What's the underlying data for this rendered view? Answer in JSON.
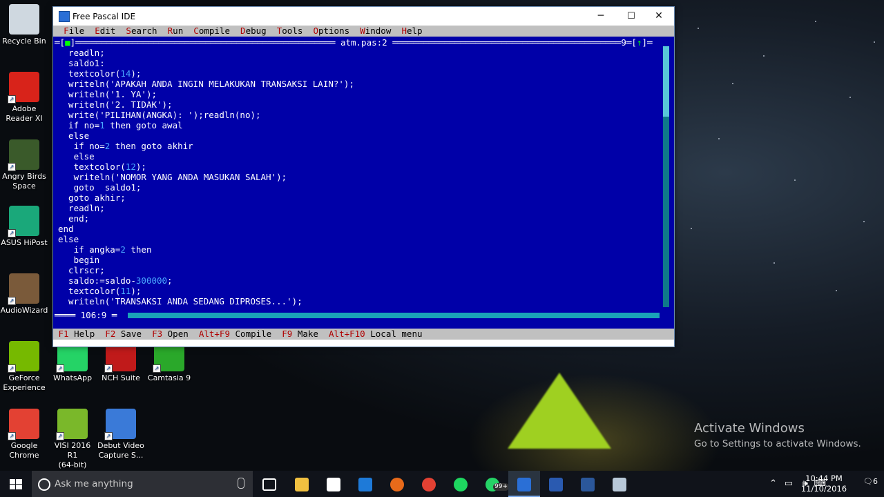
{
  "desktop": {
    "icons": [
      {
        "label": "Recycle Bin",
        "icon": "recycle-bin-icon",
        "color": "#cfd8e0"
      },
      {
        "label": "Adobe\nReader XI",
        "icon": "adobe-reader-icon",
        "color": "#d8231a"
      },
      {
        "label": "Angry Birds\nSpace",
        "icon": "angry-birds-icon",
        "color": "#3a5a2a"
      },
      {
        "label": "ASUS HiPost",
        "icon": "asus-hipost-icon",
        "color": "#1aa87a"
      },
      {
        "label": "AudioWizard",
        "icon": "audiowizard-icon",
        "color": "#7a5a3a"
      },
      {
        "label": "GeForce\nExperience",
        "icon": "geforce-icon",
        "color": "#76b900"
      },
      {
        "label": "WhatsApp",
        "icon": "whatsapp-icon",
        "color": "#25d366"
      },
      {
        "label": "NCH Suite",
        "icon": "nch-suite-icon",
        "color": "#c01a1a"
      },
      {
        "label": "Camtasia 9",
        "icon": "camtasia-icon",
        "color": "#2aa82a"
      },
      {
        "label": "Google\nChrome",
        "icon": "chrome-icon",
        "color": "#e34133"
      },
      {
        "label": "VISI 2016 R1\n(64-bit)",
        "icon": "visi-icon",
        "color": "#7ab82a"
      },
      {
        "label": "Debut Video\nCapture S...",
        "icon": "debut-icon",
        "color": "#3a7ad8"
      }
    ],
    "activate_title": "Activate Windows",
    "activate_sub": "Go to Settings to activate Windows."
  },
  "window": {
    "title": "Free Pascal IDE",
    "minimize": "─",
    "maximize": "☐",
    "close": "✕"
  },
  "menu": [
    {
      "hot": "F",
      "rest": "ile"
    },
    {
      "hot": "E",
      "rest": "dit"
    },
    {
      "hot": "S",
      "rest": "earch"
    },
    {
      "hot": "R",
      "rest": "un"
    },
    {
      "hot": "C",
      "rest": "ompile"
    },
    {
      "hot": "D",
      "rest": "ebug"
    },
    {
      "hot": "T",
      "rest": "ools"
    },
    {
      "hot": "O",
      "rest": "ptions"
    },
    {
      "hot": "W",
      "rest": "indow"
    },
    {
      "hot": "H",
      "rest": "elp"
    }
  ],
  "editor": {
    "close_box": "[■]",
    "filename": "atm.pas:2",
    "window_number": "9",
    "zoom_box": "[↑]",
    "cursor_pos": "106:9",
    "code_lines": [
      [
        {
          "t": "  readln;"
        }
      ],
      [
        {
          "t": "  saldo1:"
        }
      ],
      [
        {
          "t": "  textcolor("
        },
        {
          "t": "14",
          "c": "num"
        },
        {
          "t": ");"
        }
      ],
      [
        {
          "t": "  writeln("
        },
        {
          "t": "'APAKAH ANDA INGIN MELAKUKAN TRANSAKSI LAIN?'",
          "c": "str"
        },
        {
          "t": ");"
        }
      ],
      [
        {
          "t": "  writeln("
        },
        {
          "t": "'1. YA'",
          "c": "str"
        },
        {
          "t": ");"
        }
      ],
      [
        {
          "t": "  writeln("
        },
        {
          "t": "'2. TIDAK'",
          "c": "str"
        },
        {
          "t": ");"
        }
      ],
      [
        {
          "t": "  write("
        },
        {
          "t": "'PILIHAN(ANGKA): '",
          "c": "str"
        },
        {
          "t": ");readln(no);"
        }
      ],
      [
        {
          "t": "  if no="
        },
        {
          "t": "1",
          "c": "num"
        },
        {
          "t": " then goto awal"
        }
      ],
      [
        {
          "t": "  else"
        }
      ],
      [
        {
          "t": "   if no="
        },
        {
          "t": "2",
          "c": "num"
        },
        {
          "t": " then goto akhir"
        }
      ],
      [
        {
          "t": "   else"
        }
      ],
      [
        {
          "t": "   textcolor("
        },
        {
          "t": "12",
          "c": "num"
        },
        {
          "t": ");"
        }
      ],
      [
        {
          "t": "   writeln("
        },
        {
          "t": "'NOMOR YANG ANDA MASUKAN SALAH'",
          "c": "str"
        },
        {
          "t": ");"
        }
      ],
      [
        {
          "t": "   goto  saldo1;"
        }
      ],
      [
        {
          "t": "  goto akhir;"
        }
      ],
      [
        {
          "t": "  readln;"
        }
      ],
      [
        {
          "t": "  end;"
        }
      ],
      [
        {
          "t": "end"
        }
      ],
      [
        {
          "t": "else"
        }
      ],
      [
        {
          "t": "   if angka="
        },
        {
          "t": "2",
          "c": "num"
        },
        {
          "t": " then"
        }
      ],
      [
        {
          "t": "   begin"
        }
      ],
      [
        {
          "t": "  clrscr;"
        }
      ],
      [
        {
          "t": "  saldo:=saldo-"
        },
        {
          "t": "300000",
          "c": "num"
        },
        {
          "t": ";"
        }
      ],
      [
        {
          "t": "  textcolor("
        },
        {
          "t": "11",
          "c": "num"
        },
        {
          "t": ");"
        }
      ],
      [
        {
          "t": "  writeln("
        },
        {
          "t": "'TRANSAKSI ANDA SEDANG DIPROSES...'",
          "c": "str"
        },
        {
          "t": ");"
        }
      ]
    ]
  },
  "fnbar": [
    {
      "key": "F1",
      "label": "Help"
    },
    {
      "key": "F2",
      "label": "Save"
    },
    {
      "key": "F3",
      "label": "Open"
    },
    {
      "key": "Alt+F9",
      "label": "Compile"
    },
    {
      "key": "F9",
      "label": "Make"
    },
    {
      "key": "Alt+F10",
      "label": "Local menu"
    }
  ],
  "taskbar": {
    "search_placeholder": "Ask me anything",
    "time": "10:44 PM",
    "date": "11/10/2016",
    "badge": "99+",
    "notif_count": "6",
    "apps": [
      {
        "name": "task-view-icon",
        "color": "#10131a"
      },
      {
        "name": "file-explorer-icon",
        "color": "#f0c040"
      },
      {
        "name": "store-icon",
        "color": "#ffffff"
      },
      {
        "name": "edge-icon",
        "color": "#1e7ad8"
      },
      {
        "name": "firefox-icon",
        "color": "#e86a1a"
      },
      {
        "name": "chrome-icon",
        "color": "#e34133"
      },
      {
        "name": "spotify-icon",
        "color": "#1ed760"
      },
      {
        "name": "whatsapp-icon",
        "color": "#25d366"
      },
      {
        "name": "free-pascal-icon",
        "color": "#2a6fd6"
      },
      {
        "name": "word-v-icon",
        "color": "#2a5ab0"
      },
      {
        "name": "word-icon",
        "color": "#2b579a"
      },
      {
        "name": "notepad-icon",
        "color": "#b8c8d8"
      }
    ]
  }
}
